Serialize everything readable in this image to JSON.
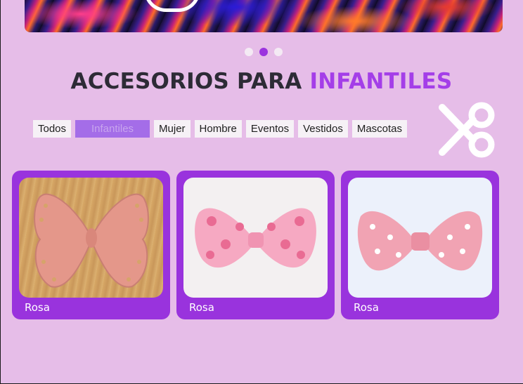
{
  "carousel": {
    "dots": 3,
    "active_index": 1
  },
  "heading": {
    "part1": "ACCESORIOS PARA",
    "part2": "INFANTILES"
  },
  "filters": [
    "Todos",
    "Infantiles",
    "Mujer",
    "Hombre",
    "Eventos",
    "Vestidos",
    "Mascotas"
  ],
  "active_filter": "Infantiles",
  "products": [
    {
      "label": "Rosa"
    },
    {
      "label": "Rosa"
    },
    {
      "label": "Rosa"
    }
  ],
  "colors": {
    "background": "#e6bde8",
    "accent": "#9933dd",
    "heading_dark": "#2d2b36",
    "heading_accent": "#a43ee8"
  }
}
